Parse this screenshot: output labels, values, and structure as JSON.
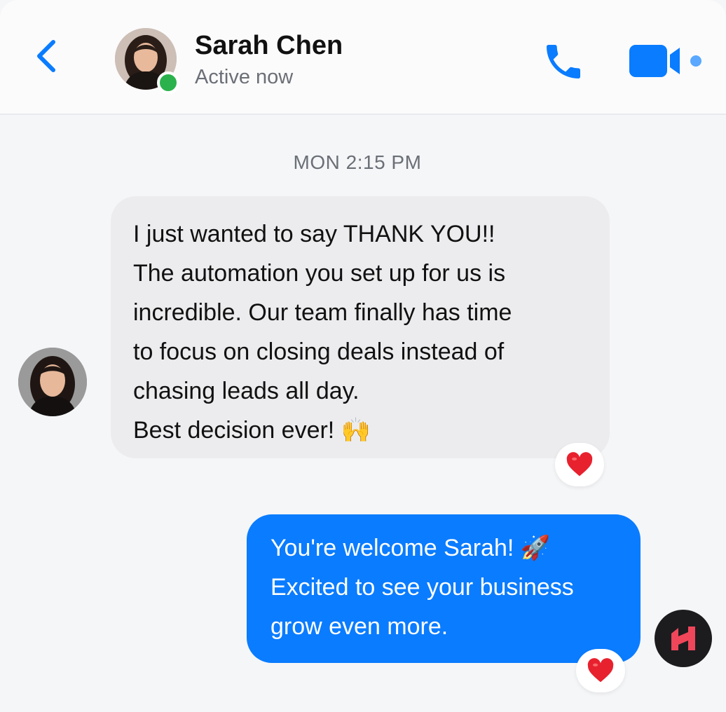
{
  "header": {
    "contact_name": "Sarah Chen",
    "status": "Active now",
    "back_icon": "chevron-left-icon",
    "call_icon": "phone-icon",
    "video_icon": "video-camera-icon"
  },
  "conversation": {
    "timestamp": "MON 2:15 PM",
    "incoming": {
      "lines": [
        "I just wanted to say THANK YOU!!",
        "The automation you set up for us is",
        "incredible. Our team finally has time",
        "to focus on closing deals instead of",
        "chasing leads all day.",
        "Best decision ever!"
      ],
      "emoji": "🙌",
      "reaction": "❤️"
    },
    "outgoing": {
      "lines": [
        "You're welcome Sarah!",
        "Excited to see your business",
        "grow even more."
      ],
      "emoji": "🚀",
      "reaction": "❤️"
    }
  },
  "colors": {
    "accent": "#0a7cff",
    "online": "#2bb24c",
    "incoming_bubble": "#ececee",
    "heart": "#e8212e",
    "logo_bg": "#1c1c1e",
    "logo_mark": "#f0465a"
  }
}
